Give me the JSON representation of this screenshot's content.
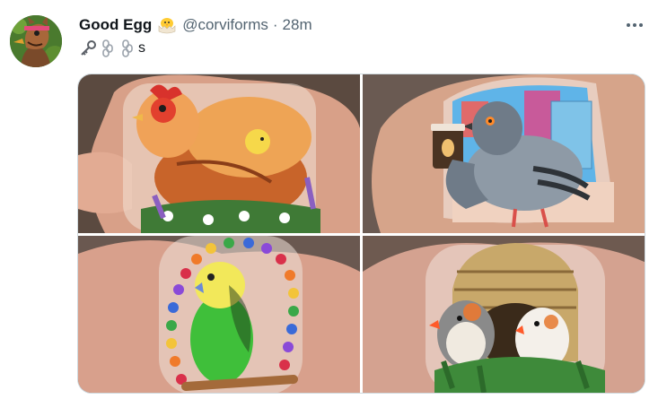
{
  "tweet": {
    "display_name": "Good Egg",
    "display_name_icon": "hatching-chick-emoji",
    "handle": "@corviforms",
    "separator": "·",
    "time": "28m",
    "text_icons": [
      "old-key-emoji",
      "chain-emoji",
      "chain-emoji"
    ],
    "text": "s",
    "more_icon": "more-dots-icon"
  },
  "media": {
    "photos": [
      {
        "subject": "chicken-and-chick-acrylic-charm"
      },
      {
        "subject": "pigeon-with-coffee-acrylic-charm"
      },
      {
        "subject": "budgie-on-perch-acrylic-charm"
      },
      {
        "subject": "zebra-finches-nest-acrylic-charm"
      }
    ]
  },
  "colors": {
    "name": "#0f1419",
    "secondary": "#536471",
    "border": "#cfd9de",
    "background": "#ffffff"
  }
}
